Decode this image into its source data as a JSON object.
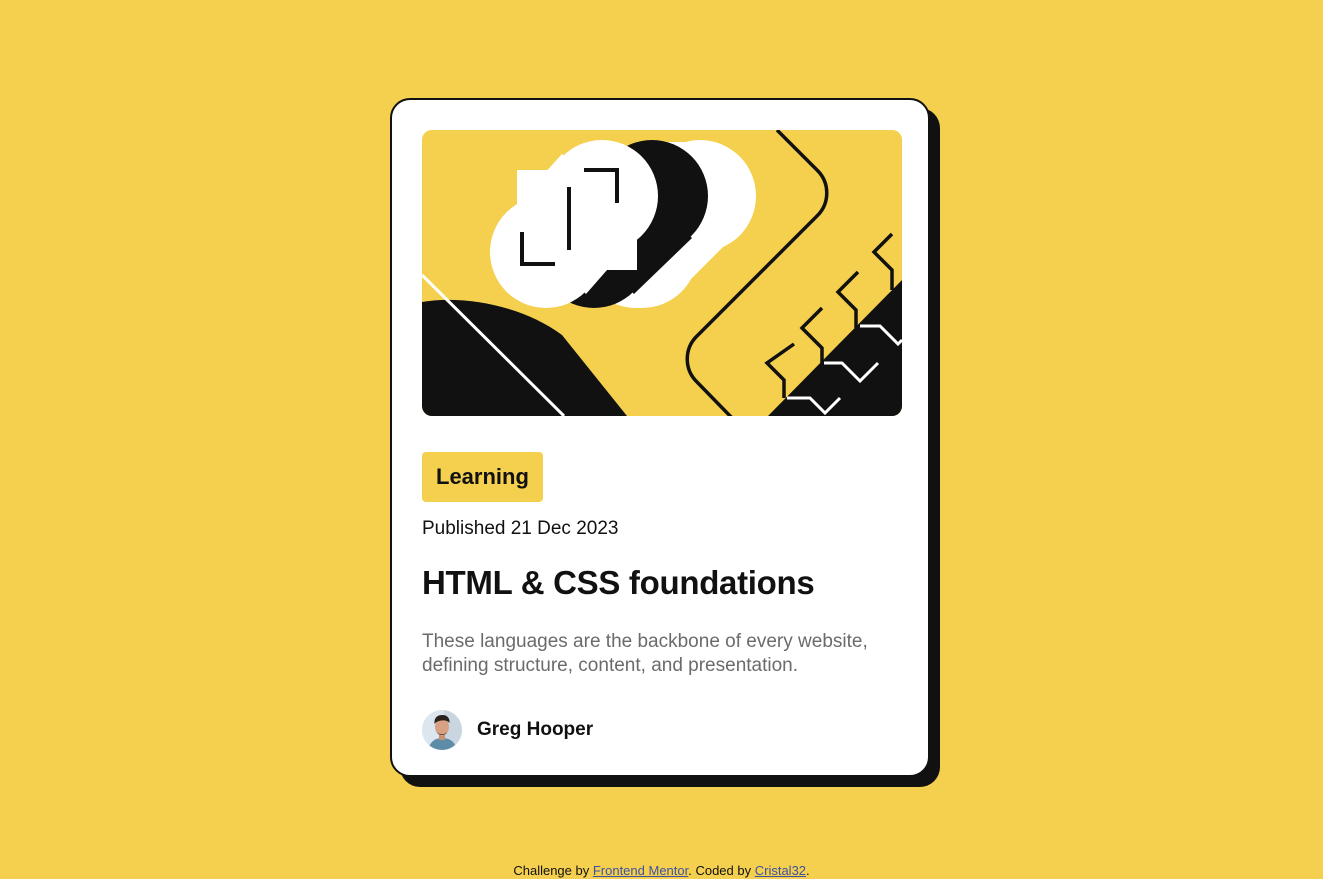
{
  "colors": {
    "background": "#F4D04E",
    "card": "#FFFFFF",
    "ink": "#111111",
    "muted_text": "#6B6B6B",
    "link": "#3E52A3"
  },
  "card": {
    "image": {
      "icon": "code-brackets-illustration"
    },
    "tag": "Learning",
    "published": "Published 21 Dec 2023",
    "title": "HTML & CSS foundations",
    "description": "These languages are the backbone of every website, defining structure, content, and presentation.",
    "author": {
      "name": "Greg Hooper",
      "avatar_icon": "user-avatar-icon"
    }
  },
  "attribution": {
    "prefix": "Challenge by ",
    "frontend_mentor_link": "Frontend Mentor",
    "middle": ". Coded by ",
    "author_link": "Cristal32",
    "suffix": "."
  }
}
